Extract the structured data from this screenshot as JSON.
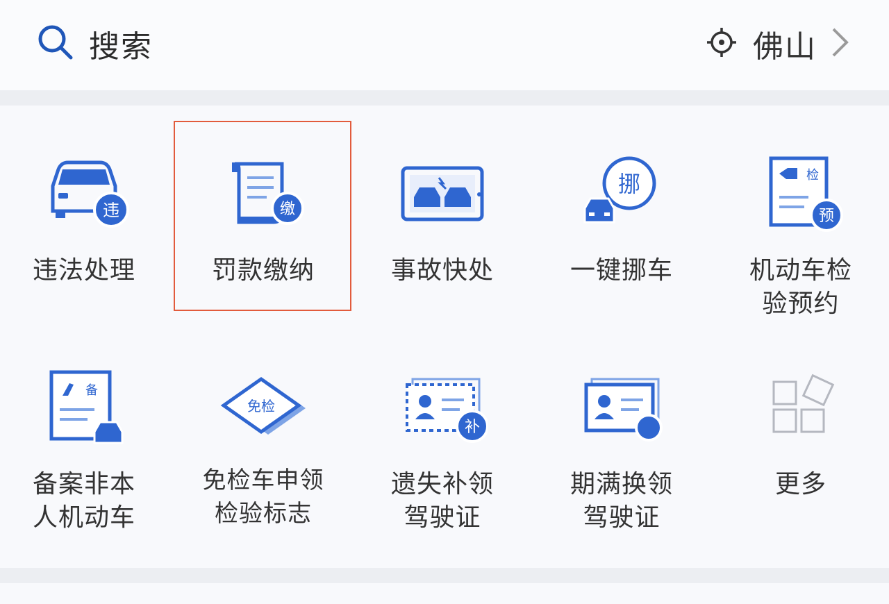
{
  "header": {
    "search_label": "搜索",
    "search_icon": "search-icon",
    "city": "佛山",
    "location_icon": "crosshair-location-icon",
    "chevron_icon": "chevron-right-icon"
  },
  "colors": {
    "accent": "#2f66d0",
    "highlight_border": "#e25b3c",
    "text": "#333333"
  },
  "services": [
    {
      "label": "违法处理",
      "icon": "violation-car-icon",
      "badge": "违"
    },
    {
      "label": "罚款缴纳",
      "icon": "fine-payment-icon",
      "badge": "缴",
      "selected": true
    },
    {
      "label": "事故快处",
      "icon": "accident-quick-icon"
    },
    {
      "label": "一键挪车",
      "icon": "move-car-icon",
      "badge": "挪"
    },
    {
      "label": "机动车检\n验预约",
      "icon": "inspection-booking-icon",
      "badge": "预",
      "tag": "检"
    },
    {
      "label": "备案非本\n人机动车",
      "icon": "register-car-icon",
      "tag": "备"
    },
    {
      "label": "免检车申领\n检验标志",
      "icon": "exempt-inspection-icon",
      "tag": "免检"
    },
    {
      "label": "遗失补领\n驾驶证",
      "icon": "reissue-license-icon",
      "badge": "补"
    },
    {
      "label": "期满换领\n驾驶证",
      "icon": "renew-license-icon"
    },
    {
      "label": "更多",
      "icon": "more-grid-icon"
    }
  ]
}
